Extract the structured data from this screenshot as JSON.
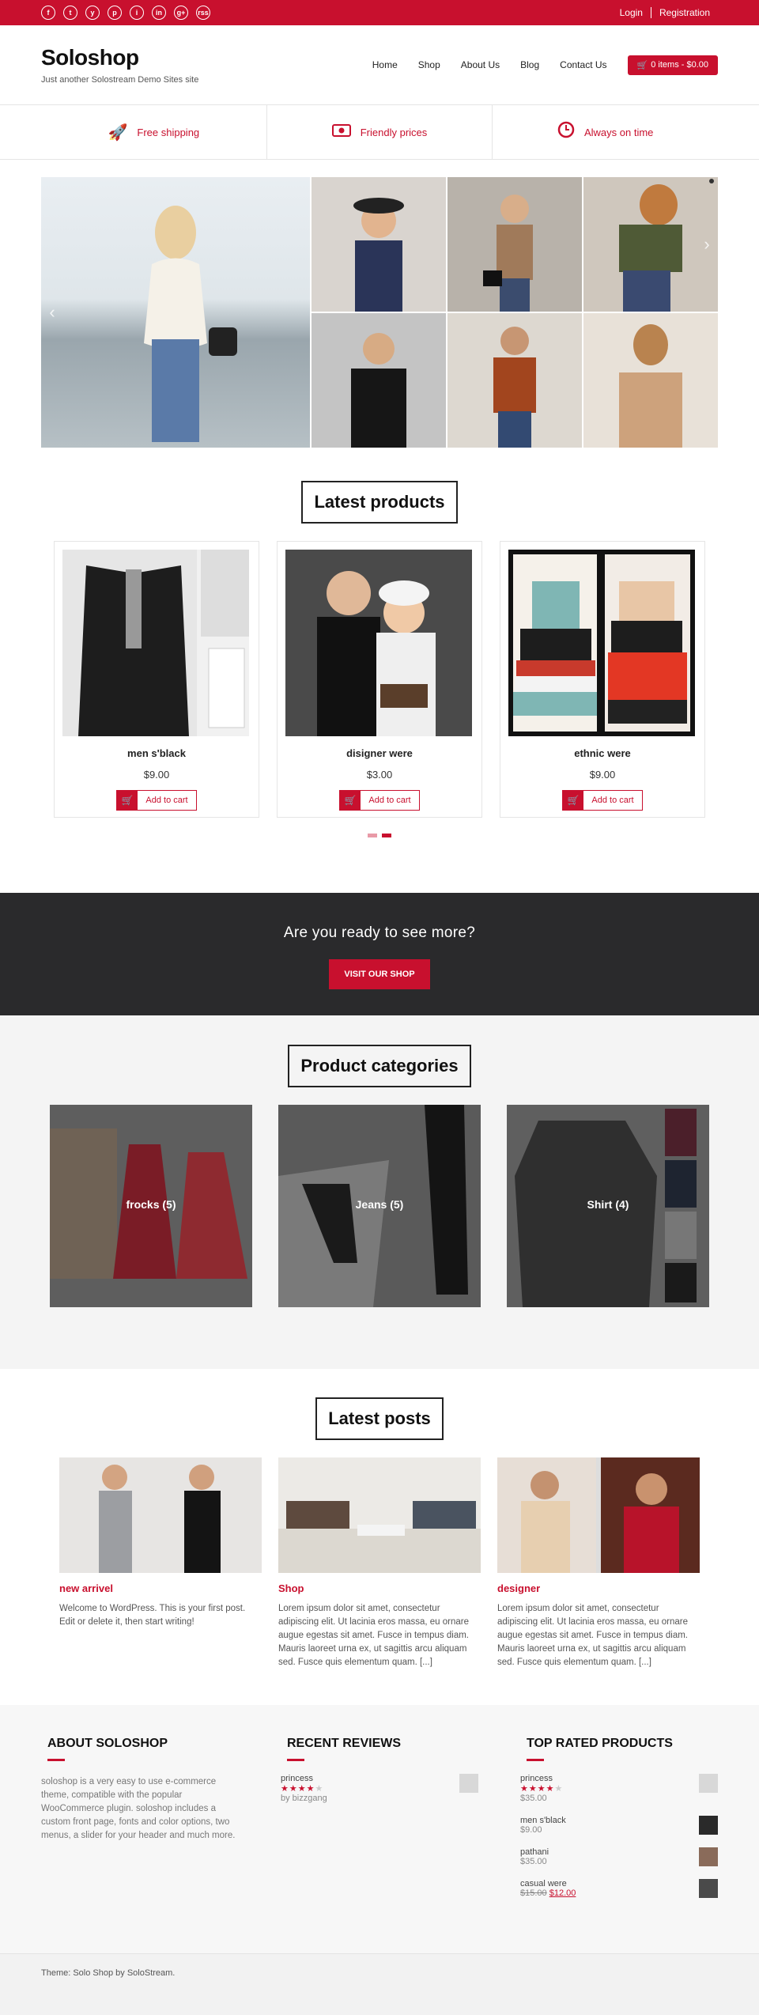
{
  "colors": {
    "accent": "#c8102e",
    "dark": "#2a2a2c"
  },
  "topbar": {
    "socials": [
      "f",
      "t",
      "y",
      "p",
      "i",
      "in",
      "g+",
      "rss"
    ],
    "login": "Login",
    "registration": "Registration"
  },
  "header": {
    "title": "Soloshop",
    "tagline": "Just another Solostream Demo Sites site",
    "nav": [
      "Home",
      "Shop",
      "About Us",
      "Blog",
      "Contact Us"
    ],
    "cart": "0 items - $0.00"
  },
  "features": [
    "Free shipping",
    "Friendly prices",
    "Always on time"
  ],
  "latest_products": {
    "heading": "Latest products",
    "items": [
      {
        "name": "men s'black",
        "price": "$9.00",
        "button": "Add to cart"
      },
      {
        "name": "disigner were",
        "price": "$3.00",
        "button": "Add to cart"
      },
      {
        "name": "ethnic were",
        "price": "$9.00",
        "button": "Add to cart"
      }
    ]
  },
  "cta": {
    "text": "Are you ready to see more?",
    "button": "VISIT OUR SHOP"
  },
  "categories": {
    "heading": "Product categories",
    "items": [
      {
        "label": "frocks  (5)"
      },
      {
        "label": "Jeans  (5)"
      },
      {
        "label": "Shirt  (4)"
      }
    ]
  },
  "latest_posts": {
    "heading": "Latest posts",
    "items": [
      {
        "title": "new arrivel",
        "excerpt": "Welcome to WordPress. This is your first post. Edit or delete it, then start writing!"
      },
      {
        "title": "Shop",
        "excerpt": "Lorem ipsum dolor sit amet, consectetur adipiscing elit. Ut lacinia eros massa, eu ornare augue egestas sit amet. Fusce in tempus diam. Mauris laoreet urna ex, ut sagittis arcu aliquam sed. Fusce quis elementum quam. [...]"
      },
      {
        "title": "designer",
        "excerpt": "Lorem ipsum dolor sit amet, consectetur adipiscing elit. Ut lacinia eros massa, eu ornare augue egestas sit amet. Fusce in tempus diam. Mauris laoreet urna ex, ut sagittis arcu aliquam sed. Fusce quis elementum quam. [...]"
      }
    ]
  },
  "widgets": {
    "about": {
      "title": "ABOUT SOLOSHOP",
      "text": "soloshop is a very easy to use e-commerce theme, compatible with the popular WooCommerce plugin. soloshop includes a custom front page, fonts and color options, two menus, a slider for your header and much more."
    },
    "reviews": {
      "title": "RECENT REVIEWS",
      "item": {
        "name": "princess",
        "rating": 4,
        "by": "by bizzgang"
      }
    },
    "top_rated": {
      "title": "TOP RATED PRODUCTS",
      "items": [
        {
          "name": "princess",
          "rating": 4,
          "price": "$35.00"
        },
        {
          "name": "men s'black",
          "price": "$9.00"
        },
        {
          "name": "pathani",
          "price": "$35.00"
        },
        {
          "name": "casual were",
          "old_price": "$15.00",
          "price": "$12.00"
        }
      ]
    }
  },
  "footer": {
    "credit": "Theme: Solo Shop by SoloStream."
  }
}
